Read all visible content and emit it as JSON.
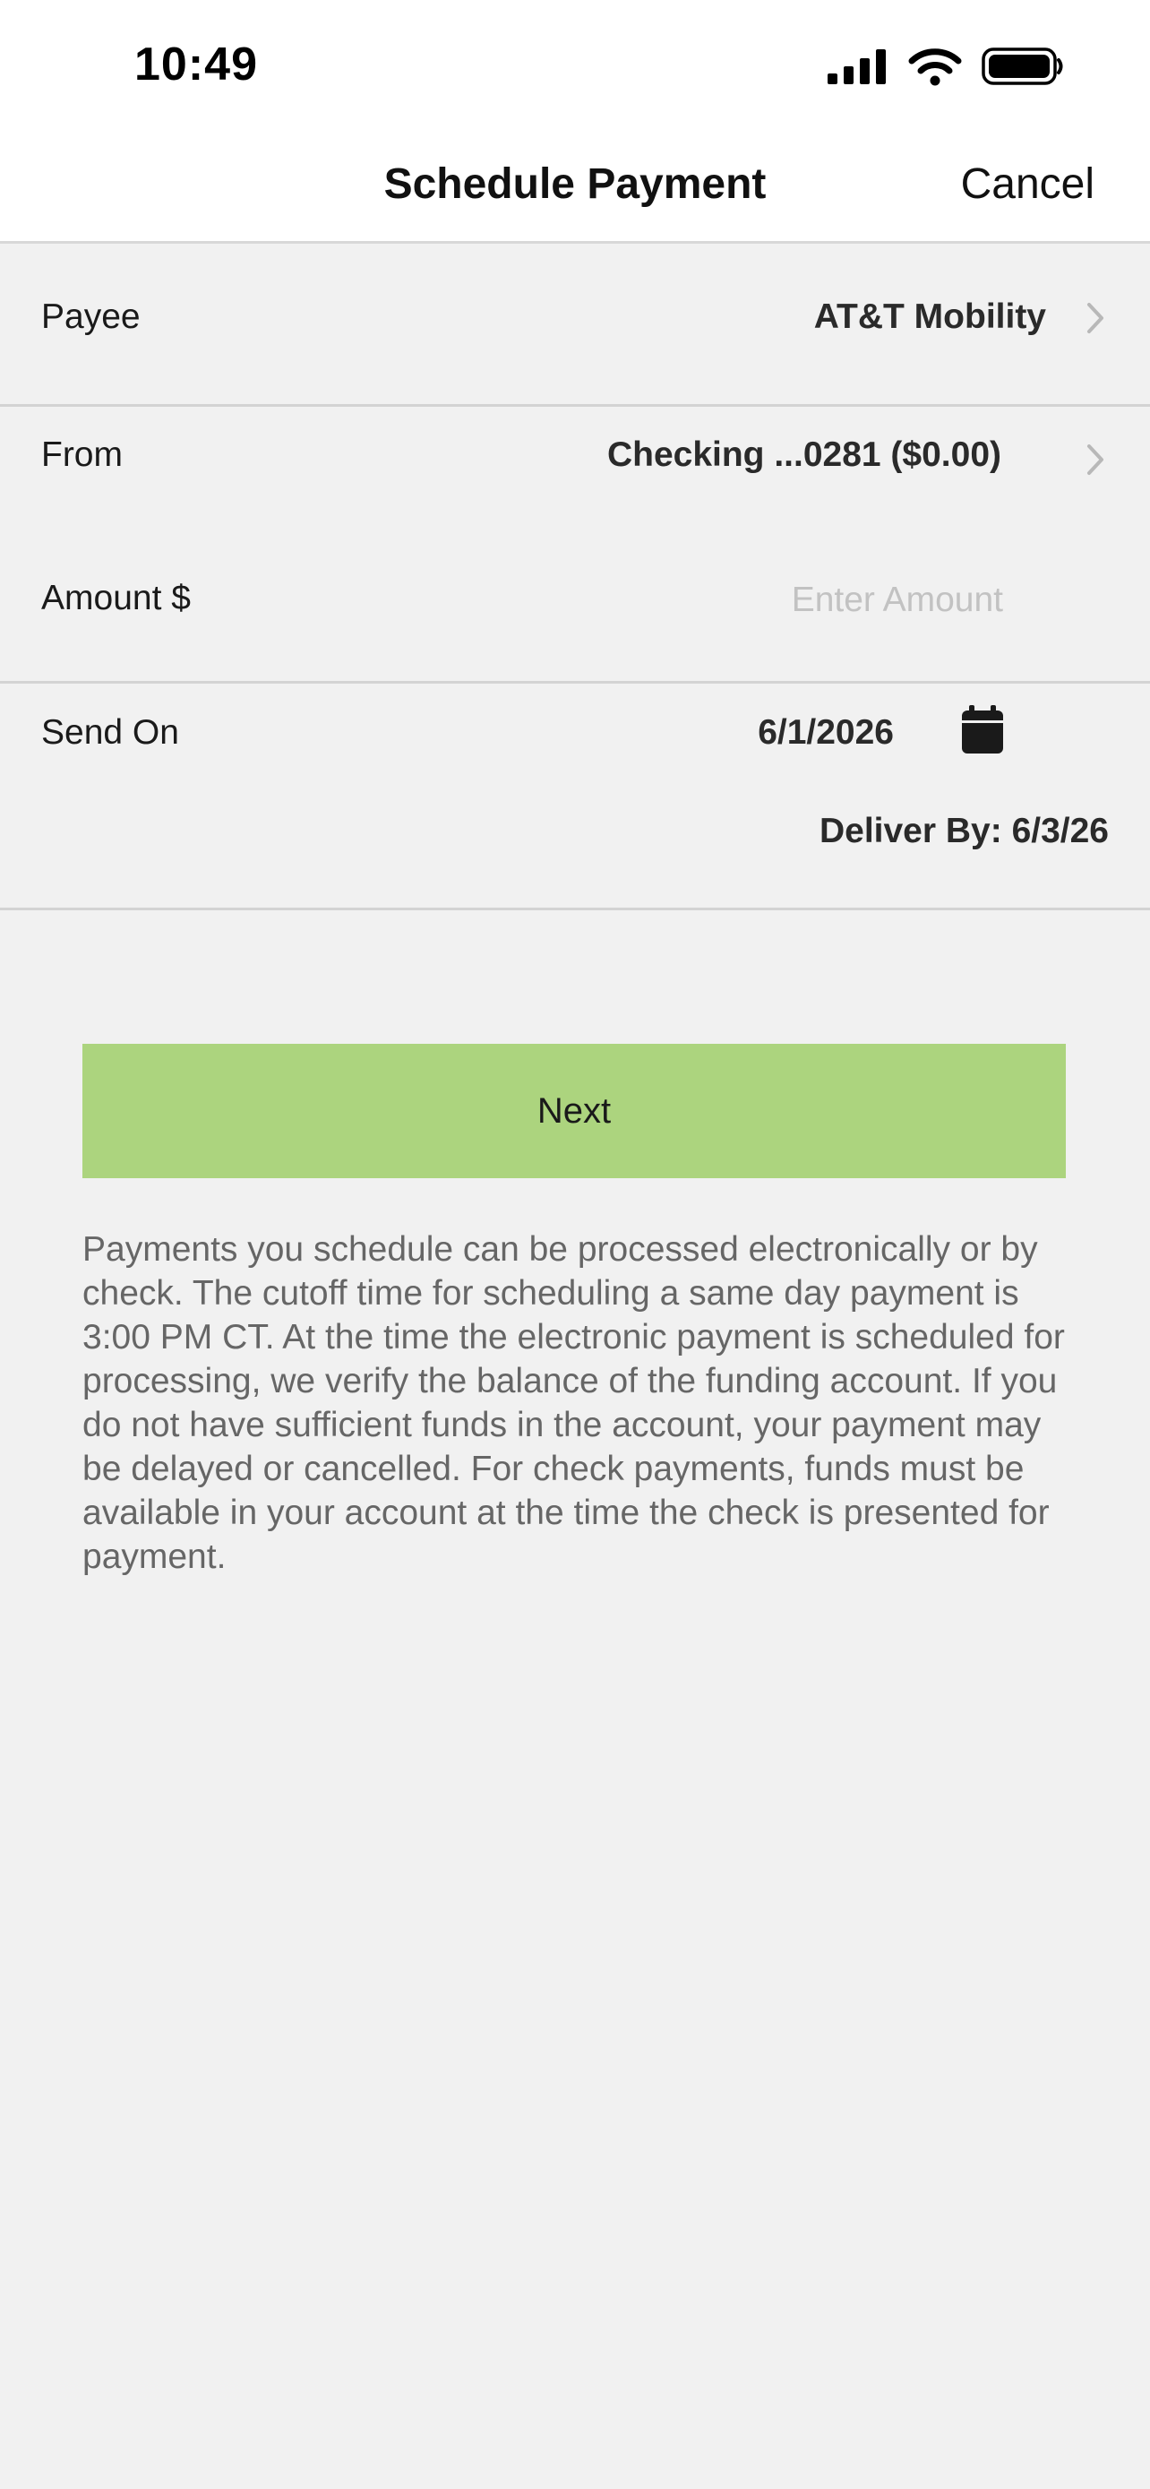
{
  "status_bar": {
    "time": "10:49"
  },
  "nav": {
    "title": "Schedule Payment",
    "cancel_label": "Cancel"
  },
  "form": {
    "payee": {
      "label": "Payee",
      "value": "AT&T Mobility"
    },
    "from": {
      "label": "From",
      "value": "Checking ...0281 ($0.00)"
    },
    "amount": {
      "label": "Amount $",
      "value": "",
      "placeholder": "Enter Amount"
    },
    "send_on": {
      "label": "Send On",
      "value": "6/1/2026",
      "deliver_by": "Deliver By: 6/3/26"
    }
  },
  "next_button": {
    "label": "Next",
    "color": "#acd47e"
  },
  "disclaimer": "Payments you schedule can be processed electronically or by check. The cutoff time for scheduling a same day payment is 3:00 PM CT. At the time the electronic payment is scheduled for processing, we verify the balance of the funding account. If you do not have sufficient funds in the account, your payment may be delayed or cancelled. For check payments, funds must be available in your account at the time the check is presented for payment.",
  "icons": {
    "signal": "cellular-signal-icon",
    "wifi": "wifi-icon",
    "battery": "battery-icon",
    "chevron": "chevron-right-icon",
    "calendar": "calendar-icon"
  }
}
